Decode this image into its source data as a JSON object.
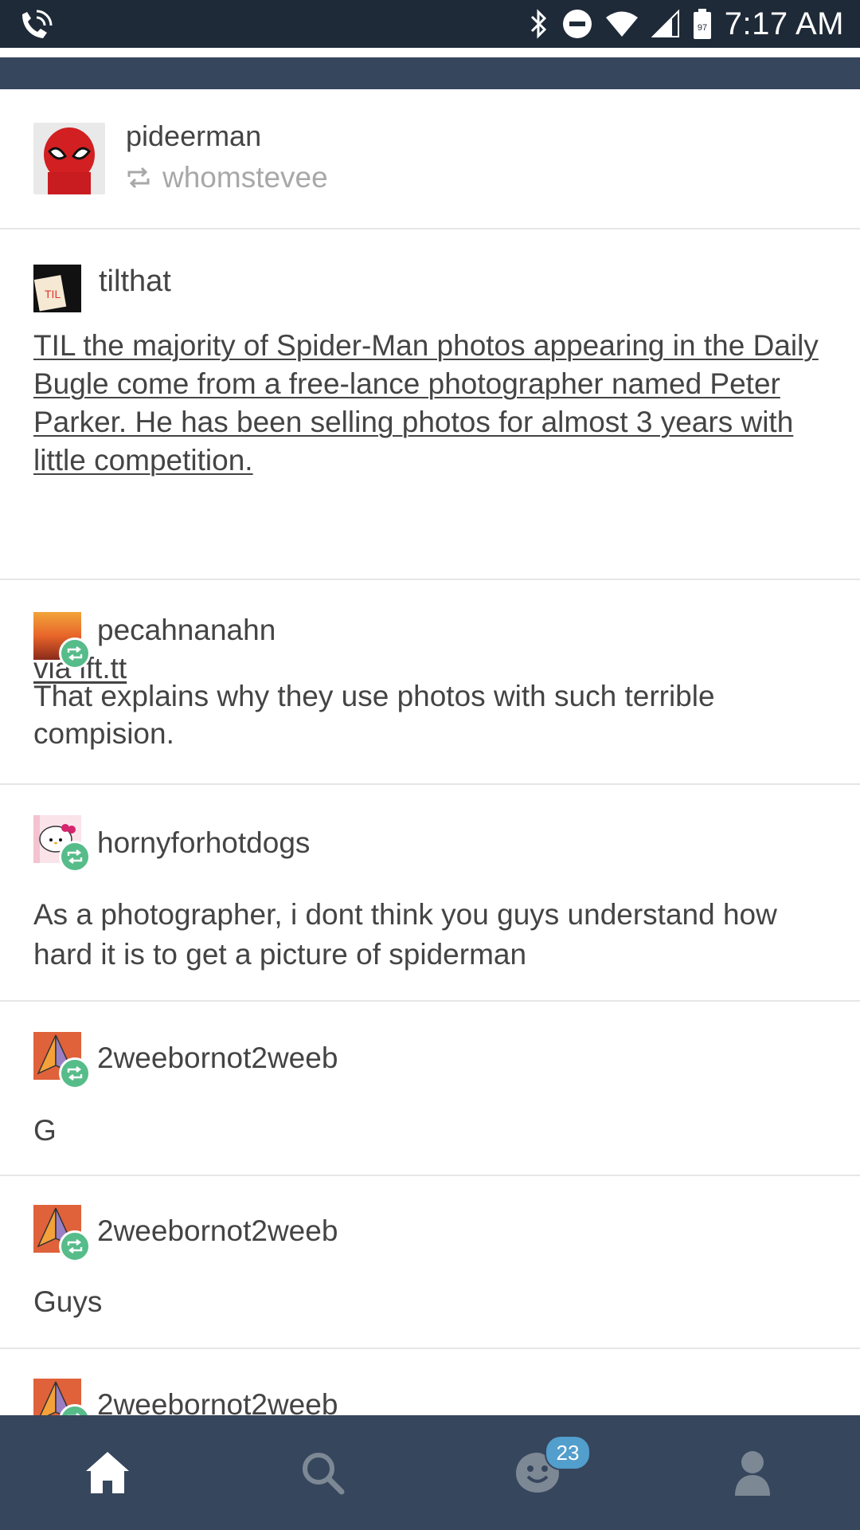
{
  "status_bar": {
    "time": "7:17 AM",
    "battery_level": "97",
    "icons": [
      "wifi-calling-icon",
      "bluetooth-icon",
      "do-not-disturb-icon",
      "wifi-icon",
      "signal-icon",
      "battery-icon"
    ]
  },
  "post": {
    "poster": "pideerman",
    "reblogged_from": "whomstevee",
    "trail": [
      {
        "username": "tilthat",
        "body": "TIL the majority of Spider-Man photos appearing in the Daily Bugle come from a free-lance photographer named Peter Parker. He has been selling photos for almost 3 years with little competition.",
        "via": "via ift.tt"
      },
      {
        "username": "pecahnanahn",
        "body": "That explains why they use photos with such terrible compision."
      },
      {
        "username": "hornyforhotdogs",
        "body": "As a photographer, i dont think you guys understand how hard it is to get a picture of spiderman"
      },
      {
        "username": "2weebornot2weeb",
        "body": "G"
      },
      {
        "username": "2weebornot2weeb",
        "body": "Guys"
      },
      {
        "username": "2weebornot2weeb",
        "body": ""
      }
    ]
  },
  "bottom_nav": {
    "items": [
      "home-icon",
      "search-icon",
      "activity-icon",
      "account-icon"
    ],
    "activity_count": "23"
  },
  "colors": {
    "nav_background": "#36465d",
    "status_background": "#1f2a38",
    "reblog_badge": "#56bc8a",
    "notification_badge": "#529ecc"
  }
}
